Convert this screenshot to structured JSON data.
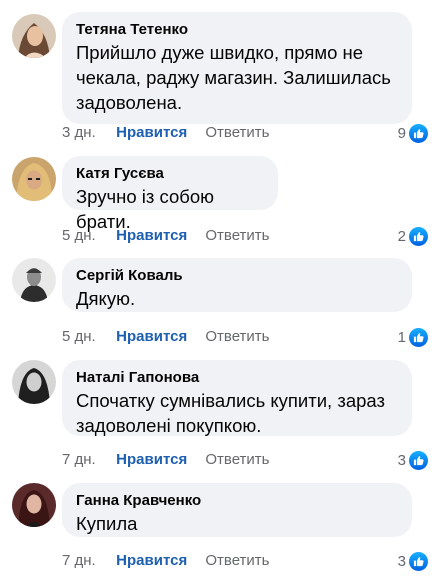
{
  "actions": {
    "like_label": "Нравится",
    "reply_label": "Ответить"
  },
  "colors": {
    "bubble": "#f0f2f5",
    "like_link": "#1d5fb0",
    "meta_text": "#65676b",
    "like_icon": "#0c7af3"
  },
  "comments": [
    {
      "author": "Тетяна Тетенко",
      "text": "Прийшло дуже швидко, прямо не чекала, раджу магазин. Залишилась задоволена.",
      "time": "3 дн.",
      "reactions": "9",
      "reaction_icon": "like-icon"
    },
    {
      "author": "Катя Гусєва",
      "text": "Зручно із собою брати.",
      "time": "5 дн.",
      "reactions": "2",
      "reaction_icon": "like-icon"
    },
    {
      "author": "Сергій Коваль",
      "text": "Дякую.",
      "time": "5 дн.",
      "reactions": "1",
      "reaction_icon": "like-icon"
    },
    {
      "author": "Наталі Гапонова",
      "text": "Спочатку сумнівались купити, зараз задоволені покупкою.",
      "time": "7 дн.",
      "reactions": "3",
      "reaction_icon": "like-icon"
    },
    {
      "author": "Ганна Кравченко",
      "text": "Купила",
      "time": "7 дн.",
      "reactions": "3",
      "reaction_icon": "like-icon"
    }
  ]
}
